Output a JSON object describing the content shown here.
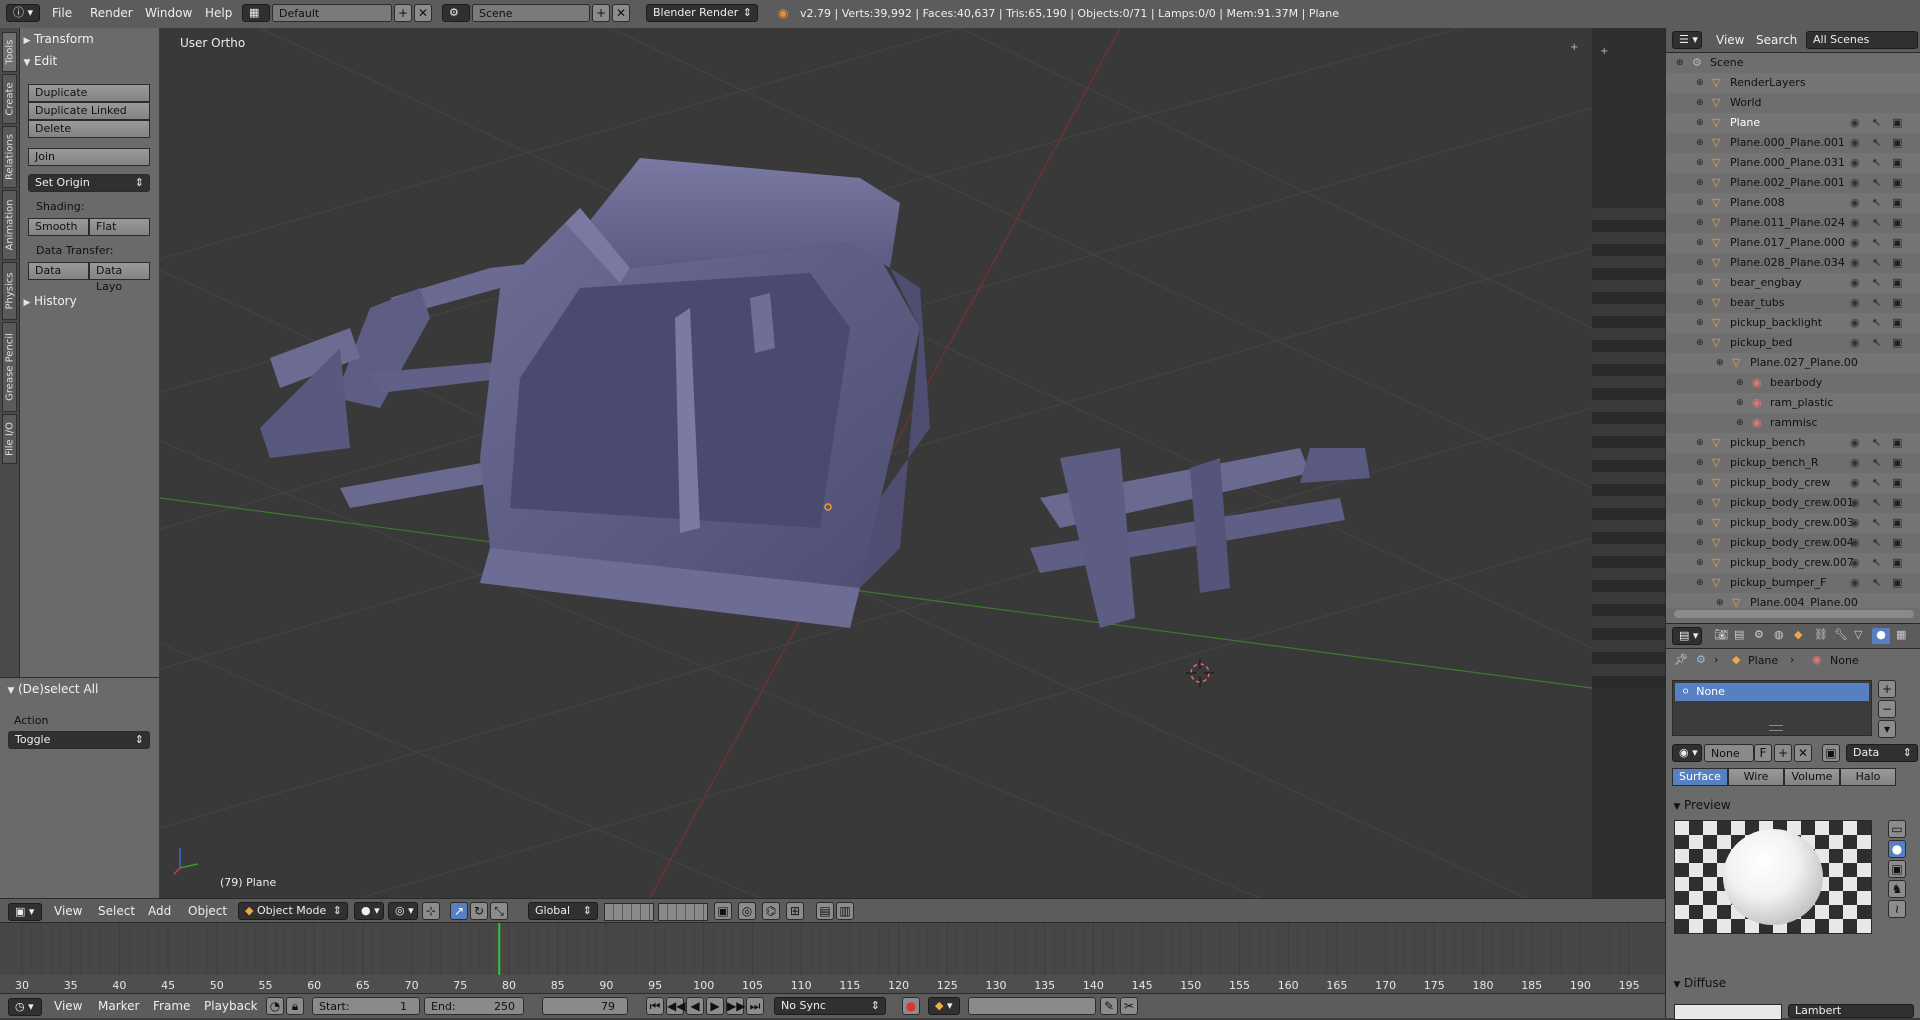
{
  "topbar": {
    "menus": [
      "File",
      "Render",
      "Window",
      "Help"
    ],
    "layout": "Default",
    "scene": "Scene",
    "engine": "Blender Render",
    "stats": "v2.79 | Verts:39,992 | Faces:40,637 | Tris:65,190 | Objects:0/71 | Lamps:0/0 | Mem:91.37M | Plane"
  },
  "tabs": [
    "Tools",
    "Create",
    "Relations",
    "Animation",
    "Physics",
    "Grease Pencil",
    "File I/O"
  ],
  "shelf": {
    "transform": "Transform",
    "edit": "Edit",
    "buttons": [
      "Duplicate",
      "Duplicate Linked",
      "Delete"
    ],
    "join": "Join",
    "set_origin": "Set Origin",
    "shading_label": "Shading:",
    "smooth": "Smooth",
    "flat": "Flat",
    "data_transfer_label": "Data Transfer:",
    "data": "Data",
    "data_layo": "Data Layo",
    "history": "History"
  },
  "redo": {
    "title": "(De)select All",
    "action_label": "Action",
    "action_value": "Toggle"
  },
  "viewport": {
    "view_name": "User Ortho",
    "object_label": "(79) Plane"
  },
  "vp_header": {
    "menus": [
      "View",
      "Select",
      "Add",
      "Object"
    ],
    "mode": "Object Mode",
    "orientation": "Global"
  },
  "timeline": {
    "ticks": [
      "30",
      "35",
      "40",
      "45",
      "50",
      "55",
      "60",
      "65",
      "70",
      "75",
      "80",
      "85",
      "90",
      "95",
      "100",
      "105",
      "110",
      "115",
      "120",
      "125",
      "130",
      "135",
      "140",
      "145",
      "150",
      "155",
      "160",
      "165",
      "170",
      "175",
      "180",
      "185",
      "190",
      "195"
    ],
    "current_frame": 79,
    "menus": [
      "View",
      "Marker",
      "Frame",
      "Playback"
    ],
    "start_label": "Start:",
    "start": "1",
    "end_label": "End:",
    "end": "250",
    "frame": "79",
    "sync": "No Sync"
  },
  "outliner": {
    "menus": [
      "View",
      "Search"
    ],
    "scope": "All Scenes",
    "items": [
      {
        "name": "Scene",
        "indent": 0
      },
      {
        "name": "RenderLayers",
        "indent": 1
      },
      {
        "name": "World",
        "indent": 1
      },
      {
        "name": "Plane",
        "indent": 1
      },
      {
        "name": "Plane.000_Plane.001",
        "indent": 1
      },
      {
        "name": "Plane.000_Plane.031",
        "indent": 1
      },
      {
        "name": "Plane.002_Plane.001",
        "indent": 1
      },
      {
        "name": "Plane.008",
        "indent": 1
      },
      {
        "name": "Plane.011_Plane.024",
        "indent": 1
      },
      {
        "name": "Plane.017_Plane.000",
        "indent": 1
      },
      {
        "name": "Plane.028_Plane.034",
        "indent": 1
      },
      {
        "name": "bear_engbay",
        "indent": 1
      },
      {
        "name": "bear_tubs",
        "indent": 1
      },
      {
        "name": "pickup_backlight",
        "indent": 1
      },
      {
        "name": "pickup_bed",
        "indent": 1
      },
      {
        "name": "Plane.027_Plane.00",
        "indent": 2
      },
      {
        "name": "bearbody",
        "indent": 3
      },
      {
        "name": "ram_plastic",
        "indent": 3
      },
      {
        "name": "rammisc",
        "indent": 3
      },
      {
        "name": "pickup_bench",
        "indent": 1
      },
      {
        "name": "pickup_bench_R",
        "indent": 1
      },
      {
        "name": "pickup_body_crew",
        "indent": 1
      },
      {
        "name": "pickup_body_crew.001",
        "indent": 1
      },
      {
        "name": "pickup_body_crew.003",
        "indent": 1
      },
      {
        "name": "pickup_body_crew.004",
        "indent": 1
      },
      {
        "name": "pickup_body_crew.007",
        "indent": 1
      },
      {
        "name": "pickup_bumper_F",
        "indent": 1
      },
      {
        "name": "Plane.004_Plane.00",
        "indent": 2
      }
    ]
  },
  "props": {
    "crumb_object": "Plane",
    "crumb_material": "None",
    "slot": "None",
    "mat_name": "None",
    "mat_f": "F",
    "link": "Data",
    "tabs": [
      "Surface",
      "Wire",
      "Volume",
      "Halo"
    ],
    "preview": "Preview",
    "diffuse": "Diffuse",
    "diffuse_shader": "Lambert"
  },
  "colors": {
    "accent": "#5680c2",
    "model": "#6b6a8f"
  }
}
